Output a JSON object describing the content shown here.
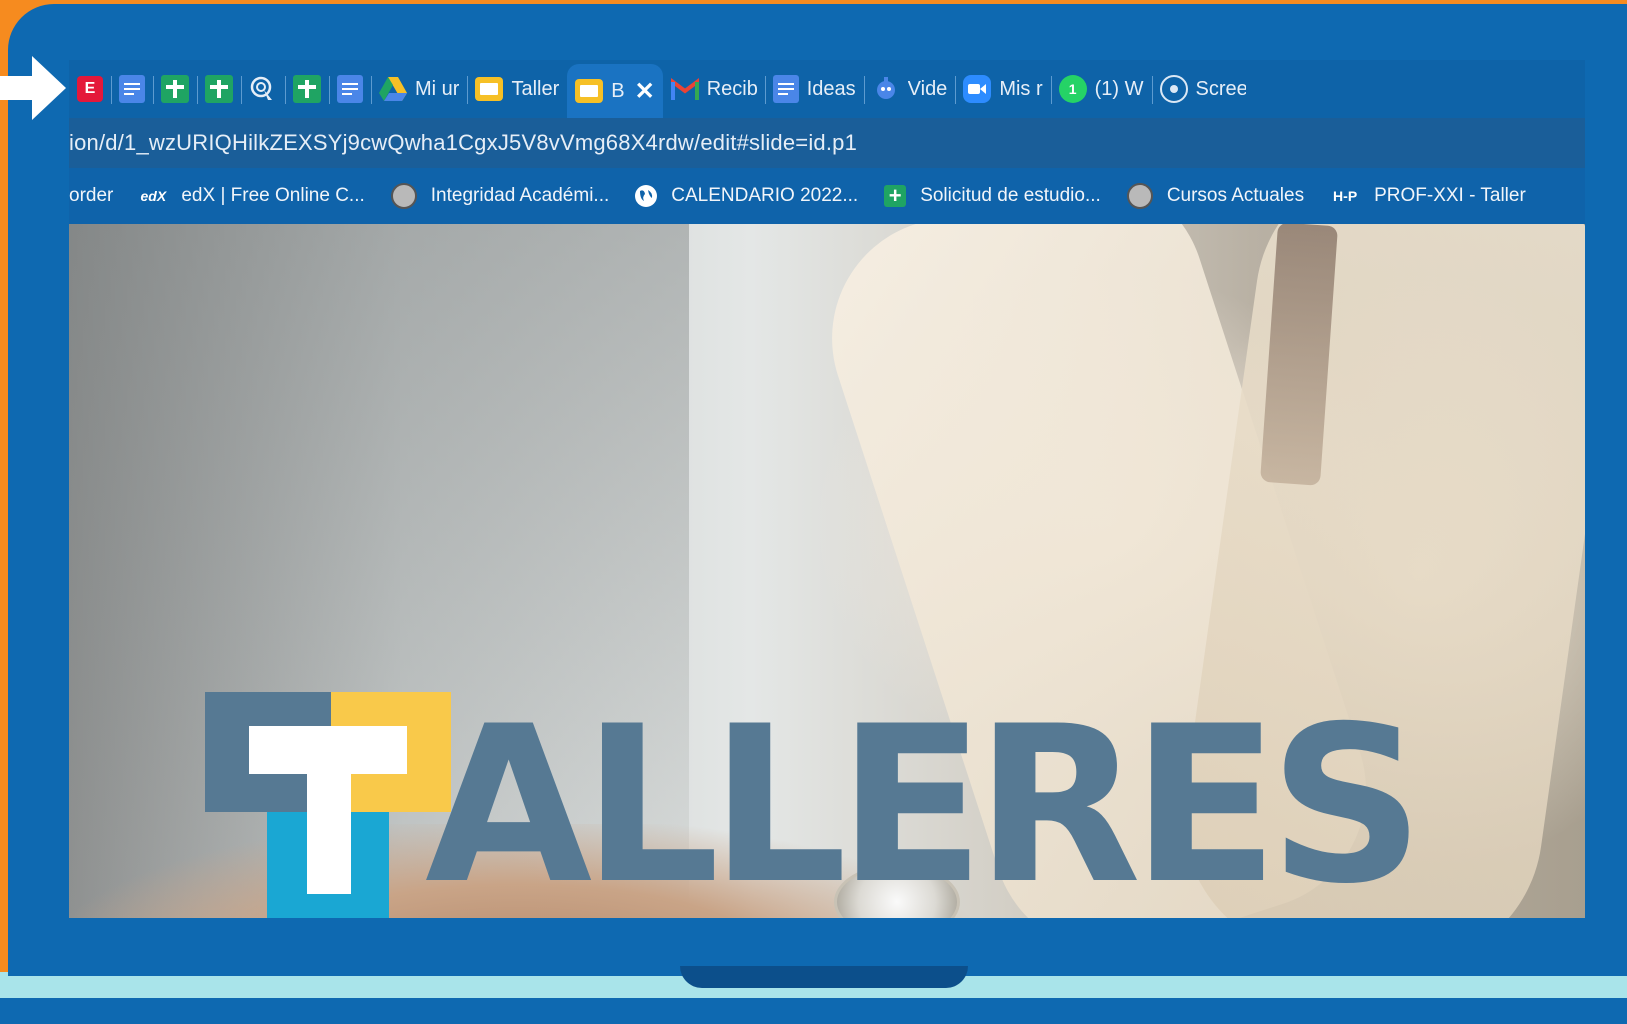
{
  "tabs": [
    {
      "icon": "e-icon",
      "icon_text": "E",
      "label": ""
    },
    {
      "icon": "google-docs-icon",
      "label": ""
    },
    {
      "icon": "google-sheets-icon",
      "label": ""
    },
    {
      "icon": "google-sheets-icon",
      "label": ""
    },
    {
      "icon": "hand-pointer-icon",
      "label": ""
    },
    {
      "icon": "google-sheets-icon",
      "label": ""
    },
    {
      "icon": "google-docs-icon",
      "label": ""
    },
    {
      "icon": "google-drive-icon",
      "label": "Mi ur"
    },
    {
      "icon": "google-slides-icon",
      "label": "Taller"
    },
    {
      "icon": "google-slides-icon",
      "label": "B",
      "active": true
    },
    {
      "icon": "gmail-icon",
      "label": "Recib"
    },
    {
      "icon": "google-docs-icon",
      "label": "Ideas"
    },
    {
      "icon": "video-icon",
      "label": "Vide"
    },
    {
      "icon": "zoom-icon",
      "label": "Mis r"
    },
    {
      "icon": "whatsapp-icon",
      "icon_text": "1",
      "label": "(1) W"
    },
    {
      "icon": "record-icon",
      "label": "Scree"
    }
  ],
  "close_glyph": "✕",
  "address_bar": {
    "url": "ion/d/1_wzURIQHilkZEXSYj9cwQwha1CgxJ5V8vVmg68X4rdw/edit#slide=id.p1"
  },
  "bookmarks": [
    {
      "icon": "",
      "label": "order"
    },
    {
      "icon": "edx-icon",
      "icon_text": "edX",
      "label": "edX | Free Online C..."
    },
    {
      "icon": "avatar-icon",
      "label": "Integridad Académi..."
    },
    {
      "icon": "globe-icon",
      "label": "CALENDARIO 2022..."
    },
    {
      "icon": "google-sheets-icon",
      "icon_text": "+",
      "label": "Solicitud de estudio..."
    },
    {
      "icon": "avatar-icon",
      "label": "Cursos Actuales"
    },
    {
      "icon": "hp-icon",
      "icon_text": "H-P",
      "label": "PROF-XXI - Taller"
    }
  ],
  "slide": {
    "logo_word": "ALLERES",
    "colors": {
      "slate": "#567993",
      "yellow": "#f9c94a",
      "cyan": "#1aa7d3"
    }
  },
  "colors": {
    "frame": "#0e69b1",
    "outer": "#f68b1f",
    "accent_strip": "#a9e4ea"
  }
}
